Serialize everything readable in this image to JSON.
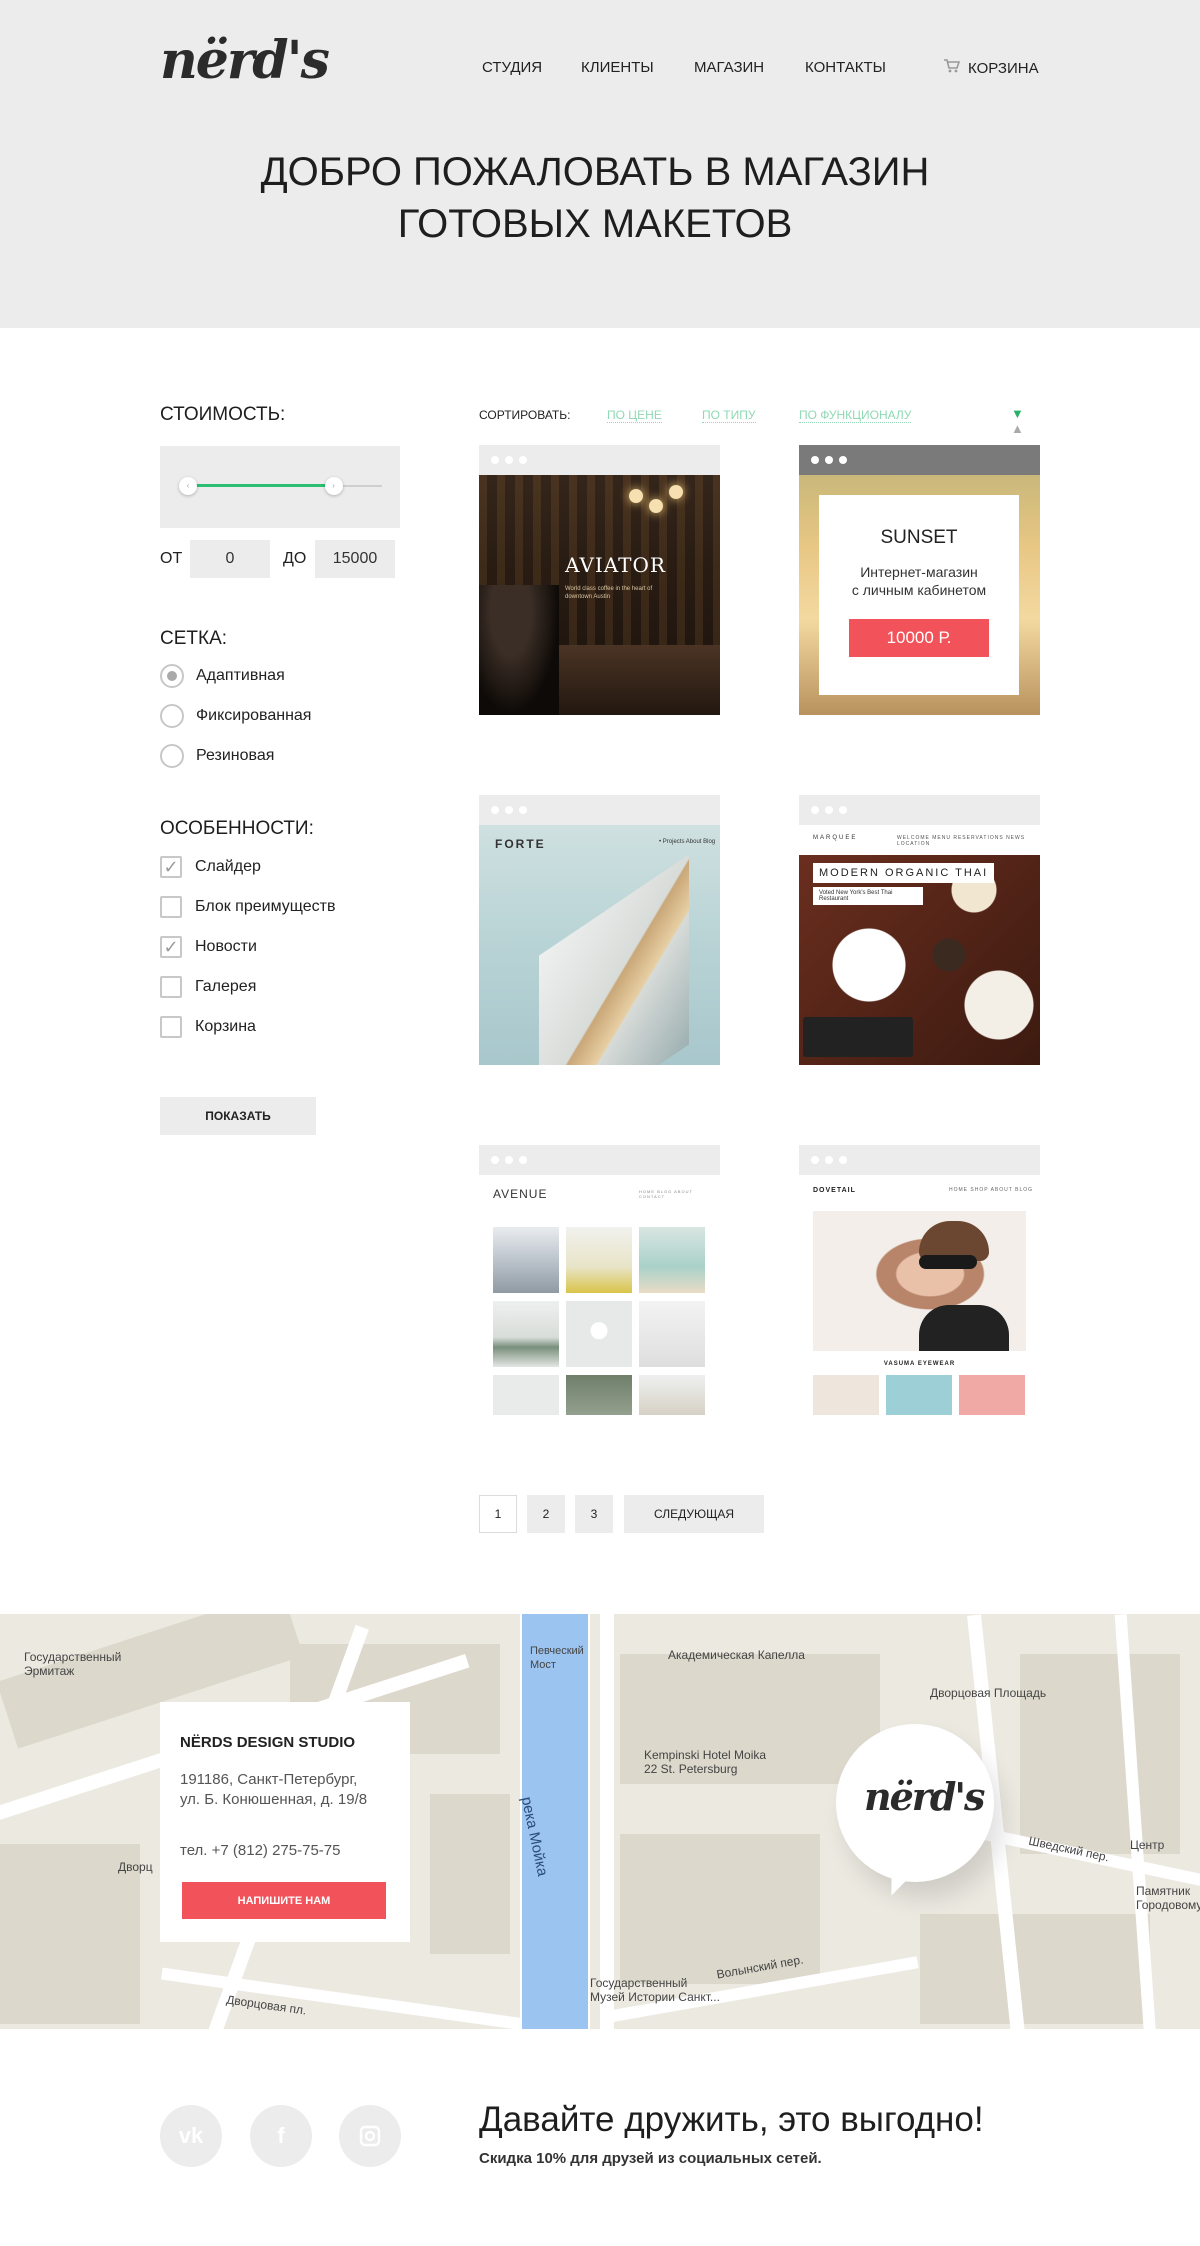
{
  "header": {
    "logo": "nërd's",
    "nav": [
      "СТУДИЯ",
      "КЛИЕНТЫ",
      "МАГАЗИН",
      "КОНТАКТЫ"
    ],
    "cart_label": "КОРЗИНА",
    "cart_icon": "cart-icon",
    "title_line1": "ДОБРО ПОЖАЛОВАТЬ В МАГАЗИН",
    "title_line2": "ГОТОВЫХ МАКЕТОВ"
  },
  "filters": {
    "price_heading": "СТОИМОСТЬ:",
    "price_from_label": "ОТ",
    "price_from": "0",
    "price_to_label": "ДО",
    "price_to": "15000",
    "slider_range": [
      0.0,
      0.75
    ],
    "grid_heading": "СЕТКА:",
    "grid_options": [
      {
        "label": "Адаптивная",
        "selected": true
      },
      {
        "label": "Фиксированная",
        "selected": false
      },
      {
        "label": "Резиновая",
        "selected": false
      }
    ],
    "features_heading": "ОСОБЕННОСТИ:",
    "features": [
      {
        "label": "Слайдер",
        "checked": true
      },
      {
        "label": "Блок преимуществ",
        "checked": false
      },
      {
        "label": "Новости",
        "checked": true
      },
      {
        "label": "Галерея",
        "checked": false
      },
      {
        "label": "Корзина",
        "checked": false
      }
    ],
    "show_button": "ПОКАЗАТЬ"
  },
  "sort": {
    "label": "СОРТИРОВАТЬ:",
    "options": [
      "ПО ЦЕНЕ",
      "ПО ТИПУ",
      "ПО ФУНКЦИОНАЛУ"
    ],
    "accent_color": "#2bbf72"
  },
  "products": {
    "aviator": {
      "brand": "AVIATOR",
      "tagline": "World class coffee in the heart of downtown Austin"
    },
    "sunset": {
      "name": "SUNSET",
      "desc_line1": "Интернет-магазин",
      "desc_line2": "с личным кабинетом",
      "price": "10000 Р."
    },
    "forte": {
      "brand": "FORTE",
      "menu": "• Projects   About   Blog"
    },
    "thai": {
      "brand": "MARQUEE",
      "menu": "WELCOME  MENU  RESERVATIONS  NEWS  LOCATION",
      "headline": "MODERN ORGANIC THAI",
      "sub": "Voted New York's Best Thai Restaurant"
    },
    "avenue": {
      "brand": "AVENUE",
      "menu": "HOME  BLOG  ABOUT  CONTACT"
    },
    "dovetail": {
      "brand": "DOVETAIL",
      "menu": "HOME  SHOP  ABOUT  BLOG",
      "caption": "VASUMA EYEWEAR"
    }
  },
  "pagination": {
    "pages": [
      "1",
      "2",
      "3"
    ],
    "next": "СЛЕДУЮЩАЯ"
  },
  "map": {
    "labels": {
      "hermitage": "Государственный\nЭрмитаж",
      "bridge": "Певческий\nМост",
      "capella": "Академическая Капелла",
      "square": "Дворцовая Площадь",
      "kempinski": "Kempinski Hotel Moika\n22 St. Petersburg",
      "museum": "Государственный\nМузей Истории Санкт...",
      "volynsky": "Волынский пер.",
      "shvedsky": "Шведский пер.",
      "center": "Центр",
      "monument": "Памятник\nГородовому",
      "moika": "река Мойка",
      "dvorc": "Дворц",
      "dvorcovaya": "Дворцовая пл."
    },
    "info": {
      "title": "NЁRDS DESIGN STUDIO",
      "address_line1": "191186, Санкт-Петербург,",
      "address_line2": "ул. Б. Конюшенная, д. 19/8",
      "phone": "тел. +7 (812) 275-75-75",
      "button": "НАПИШИТЕ НАМ"
    },
    "pin_logo": "nërd's"
  },
  "footer": {
    "social": [
      {
        "icon": "vk-icon",
        "glyph": "vk"
      },
      {
        "icon": "facebook-icon",
        "glyph": "f"
      },
      {
        "icon": "instagram-icon",
        "glyph": "◻"
      }
    ],
    "heading": "Давайте дружить, это выгодно!",
    "subheading": "Скидка 10% для друзей из социальных сетей."
  }
}
